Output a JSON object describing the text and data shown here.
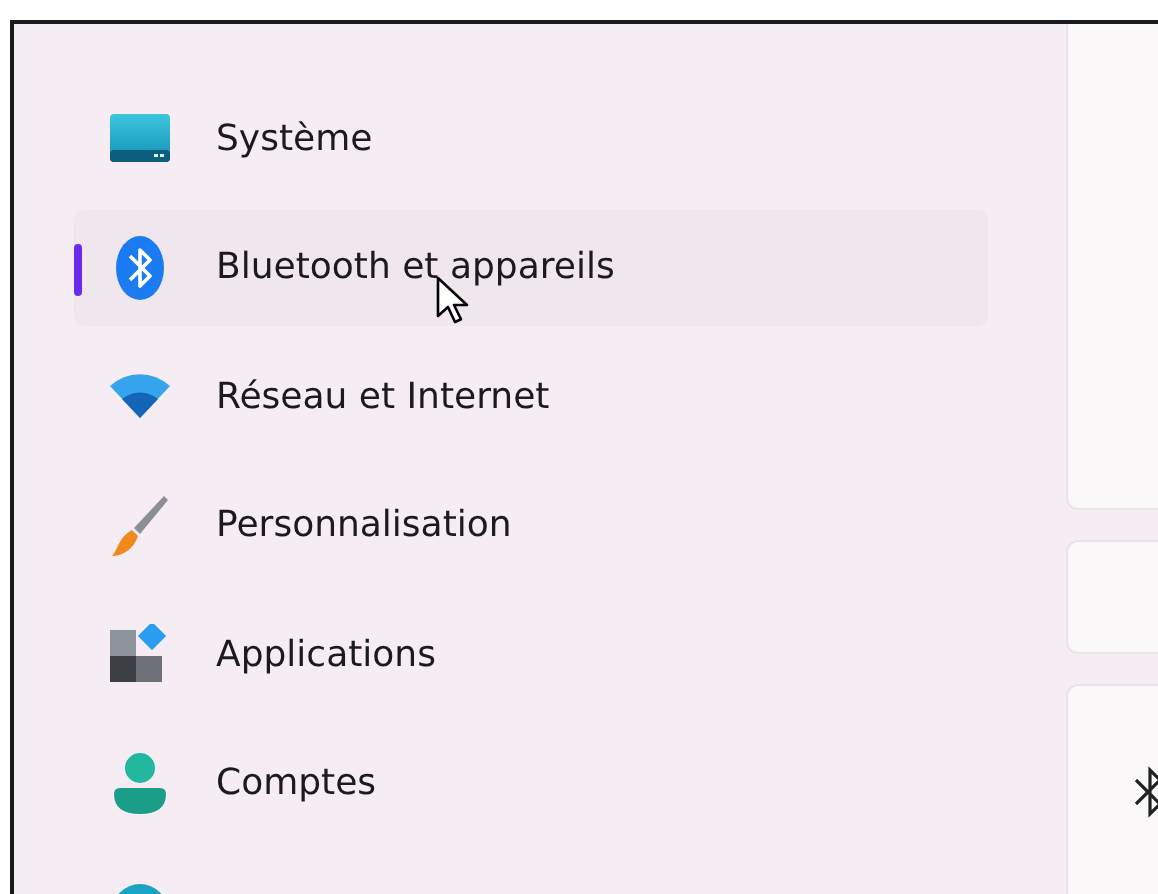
{
  "sidebar": {
    "items": [
      {
        "label": "Système",
        "selected": false
      },
      {
        "label": "Bluetooth et appareils",
        "selected": true
      },
      {
        "label": "Réseau et Internet",
        "selected": false
      },
      {
        "label": "Personnalisation",
        "selected": false
      },
      {
        "label": "Applications",
        "selected": false
      },
      {
        "label": "Comptes",
        "selected": false
      },
      {
        "selected": false
      }
    ]
  }
}
